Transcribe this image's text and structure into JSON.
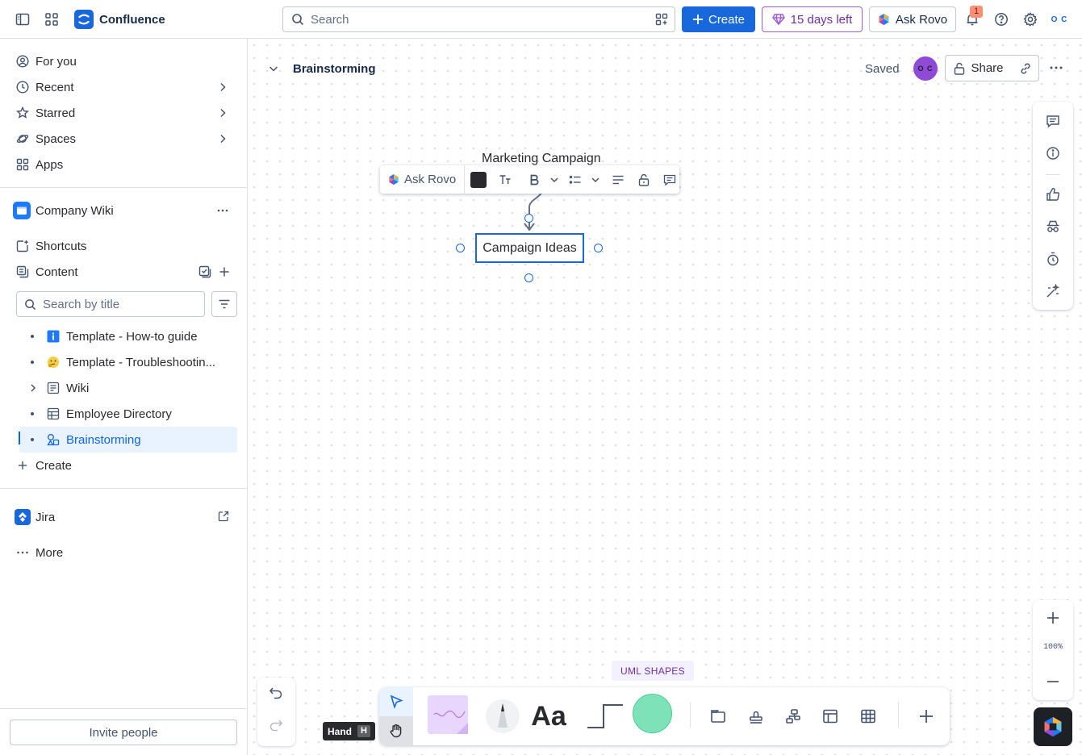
{
  "app": {
    "name": "Confluence",
    "search_placeholder": "Search",
    "create_label": "Create",
    "trial_label": "15 days left",
    "ask_rovo_label": "Ask Rovo",
    "notification_count": "1",
    "avatar_initials": "O C"
  },
  "sidebar": {
    "nav": [
      {
        "label": "For you"
      },
      {
        "label": "Recent"
      },
      {
        "label": "Starred"
      },
      {
        "label": "Spaces"
      },
      {
        "label": "Apps"
      }
    ],
    "space_name": "Company Wiki",
    "shortcuts_label": "Shortcuts",
    "content_label": "Content",
    "search_placeholder": "Search by title",
    "tree": [
      {
        "label": "Template - How-to guide"
      },
      {
        "label": "Template - Troubleshootin..."
      },
      {
        "label": "Wiki"
      },
      {
        "label": "Employee Directory"
      },
      {
        "label": "Brainstorming"
      }
    ],
    "create_label": "Create",
    "jira_label": "Jira",
    "more_label": "More",
    "invite_label": "Invite people"
  },
  "page": {
    "title": "Brainstorming",
    "status": "Saved",
    "collaborator_initials": "O C",
    "share_label": "Share"
  },
  "canvas": {
    "parent_node": "Marketing Campaign",
    "selected_node": "Campaign Ideas",
    "format_bar": {
      "ask_rovo_label": "Ask Rovo",
      "text_color": "#292a2e"
    },
    "zoom_level": "100%",
    "uml_label": "UML SHAPES",
    "tooltip": {
      "label": "Hand",
      "key": "H"
    },
    "colors": {
      "accent": "#1868db",
      "sticky_note": "#e8d6ff",
      "shape_fill": "#7ee2b8",
      "trial_purple": "#6e2fa8"
    }
  }
}
